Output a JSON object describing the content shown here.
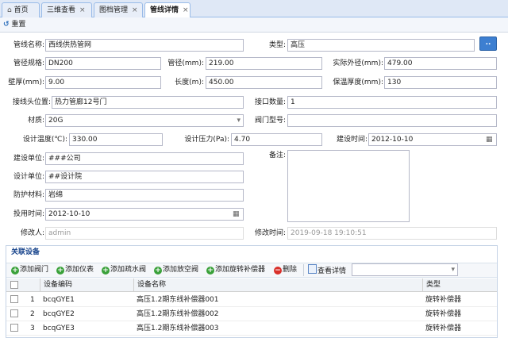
{
  "tabs": [
    {
      "label": "首页",
      "closable": false
    },
    {
      "label": "三维查看",
      "closable": true
    },
    {
      "label": "图档管理",
      "closable": true
    },
    {
      "label": "管线详情",
      "closable": true,
      "active": true
    }
  ],
  "toolbar": {
    "reset_label": "重置"
  },
  "more_button_label": "..",
  "form": {
    "pipe_name_label": "管线名称:",
    "pipe_name": "西线供热管网",
    "type_label": "类型:",
    "type": "高压",
    "spec_label": "管径规格:",
    "spec": "DN200",
    "diameter_label": "管径(mm):",
    "diameter": "219.00",
    "outer_label": "实际外径(mm):",
    "outer": "479.00",
    "wall_label": "壁厚(mm):",
    "wall": "9.00",
    "length_label": "长度(m):",
    "length": "450.00",
    "insul_label": "保温厚度(mm):",
    "insul": "130",
    "joint_pos_label": "接线头位置:",
    "joint_pos": "热力管廊12号门",
    "port_count_label": "接口数量:",
    "port_count": "1",
    "material_label": "材质:",
    "material": "20G",
    "valve_label": "阀门型号:",
    "valve": "",
    "temp_label": "设计温度(℃):",
    "temp": "330.00",
    "pressure_label": "设计压力(Pa):",
    "pressure": "4.70",
    "build_time_label": "建设时间:",
    "build_time": "2012-10-10",
    "build_unit_label": "建设单位:",
    "build_unit": "###公司",
    "remark_label": "备注:",
    "remark": "",
    "design_unit_label": "设计单位:",
    "design_unit": "##设计院",
    "protect_label": "防护材料:",
    "protect": "岩绵",
    "use_time_label": "投用时间:",
    "use_time": "2012-10-10",
    "modifier_label": "修改人:",
    "modifier": "admin",
    "modify_time_label": "修改时间:",
    "modify_time": "2019-09-18 19:10:51"
  },
  "related": {
    "title": "关联设备",
    "buttons": [
      "添加阀门",
      "添加仪表",
      "添加疏水阀",
      "添加放空阀",
      "添加旋转补偿器",
      "删除",
      "查看详情"
    ],
    "columns": [
      "设备编码",
      "设备名称",
      "类型"
    ],
    "rows": [
      {
        "no": "1",
        "code": "bcqGYE1",
        "name": "高压1.2期东线补偿器001",
        "type": "旋转补偿器"
      },
      {
        "no": "2",
        "code": "bcqGYE2",
        "name": "高压1.2期东线补偿器002",
        "type": "旋转补偿器"
      },
      {
        "no": "3",
        "code": "bcqGYE3",
        "name": "高压1.2期东线补偿器003",
        "type": "旋转补偿器"
      }
    ]
  }
}
